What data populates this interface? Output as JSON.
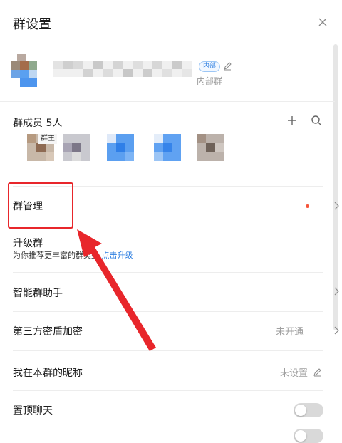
{
  "window": {
    "title": "群设置"
  },
  "group": {
    "tag": "内部",
    "type_label": "内部群"
  },
  "members": {
    "title": "群成员 5人",
    "owner_tag": "群主"
  },
  "rows": {
    "manage": {
      "label": "群管理"
    },
    "upgrade": {
      "label": "升级群",
      "desc": "为你推荐更丰富的群类型",
      "link": "点击升级"
    },
    "assistant": {
      "label": "智能群助手"
    },
    "encrypt": {
      "label": "第三方密盾加密",
      "value": "未开通"
    },
    "nickname": {
      "label": "我在本群的昵称",
      "value": "未设置"
    },
    "pin": {
      "label": "置顶聊天"
    }
  },
  "colors": {
    "accent": "#2b7de0",
    "highlight_red": "#e8262b",
    "badge_dot": "#f5553b"
  },
  "icons": [
    "close-icon",
    "edit-icon",
    "plus-icon",
    "search-icon",
    "chevron-right-icon"
  ]
}
